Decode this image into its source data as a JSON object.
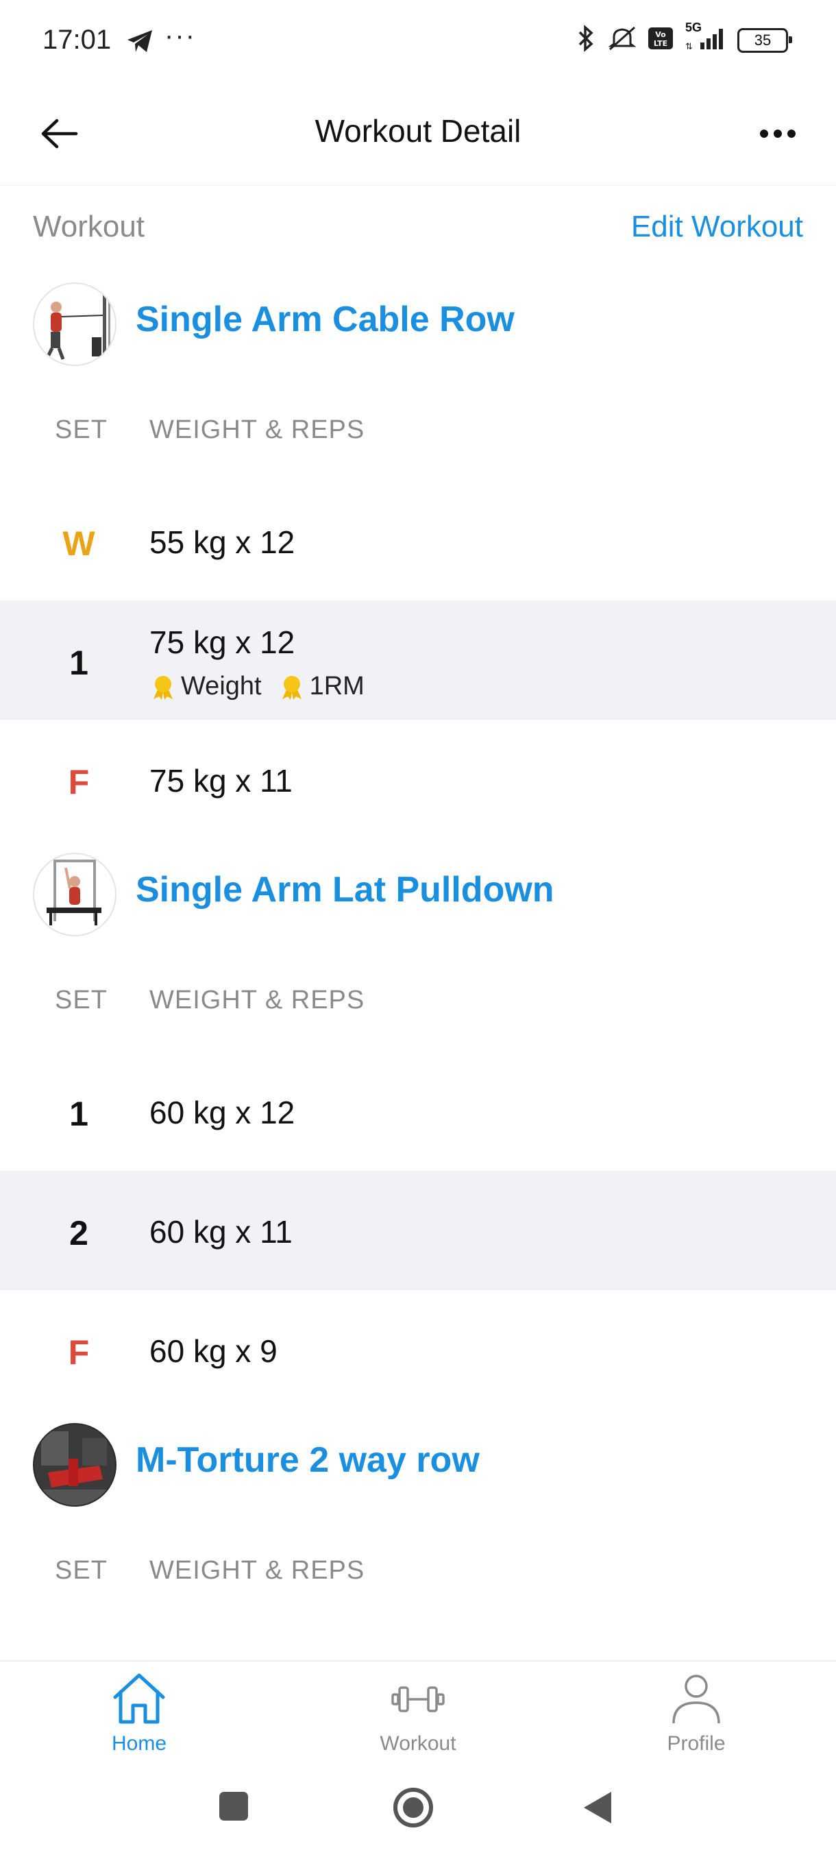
{
  "status_bar": {
    "time": "17:01",
    "network": "5G",
    "battery": "35"
  },
  "app_bar": {
    "title": "Workout Detail"
  },
  "section": {
    "label": "Workout",
    "edit_label": "Edit Workout"
  },
  "columns": {
    "set": "SET",
    "weight_reps": "WEIGHT & REPS"
  },
  "exercises": [
    {
      "name": "Single Arm Cable Row",
      "sets": [
        {
          "set": "W",
          "value": "55 kg x 12"
        },
        {
          "set": "1",
          "value": "75 kg x 12",
          "badges": [
            "Weight",
            "1RM"
          ]
        },
        {
          "set": "F",
          "value": "75 kg x 11"
        }
      ]
    },
    {
      "name": "Single Arm Lat Pulldown",
      "sets": [
        {
          "set": "1",
          "value": "60 kg x 12"
        },
        {
          "set": "2",
          "value": "60 kg x 11"
        },
        {
          "set": "F",
          "value": "60 kg x 9"
        }
      ]
    },
    {
      "name": "M-Torture 2 way row"
    }
  ],
  "bottom_nav": {
    "items": [
      {
        "label": "Home",
        "icon": "home-icon",
        "active": true
      },
      {
        "label": "Workout",
        "icon": "dumbbell-icon",
        "active": false
      },
      {
        "label": "Profile",
        "icon": "profile-icon",
        "active": false
      }
    ]
  },
  "colors": {
    "accent": "#1a8fe0",
    "warmup": "#e8a317",
    "failure": "#de4a3a",
    "muted": "#8a8a8a",
    "row_shade": "#f0f2f5"
  }
}
